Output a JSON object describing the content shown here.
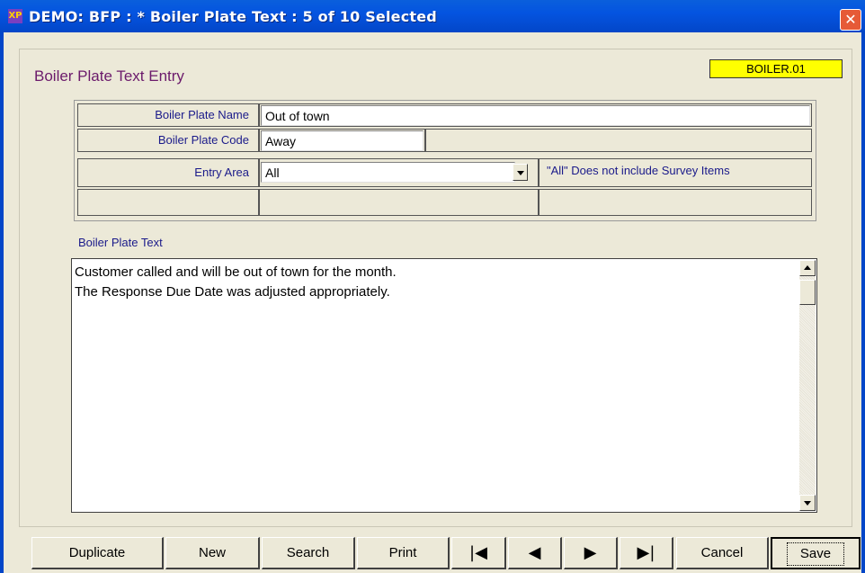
{
  "window": {
    "title": "DEMO:  BFP : * Boiler Plate Text : 5 of 10 Selected",
    "app_icon_text": "XP",
    "close_symbol": "✕"
  },
  "form": {
    "title": "Boiler Plate Text Entry",
    "badge": "BOILER.01",
    "badge_color": "#ffff00",
    "name_label": "Boiler Plate Name",
    "name_value": "Out of town",
    "code_label": "Boiler Plate Code",
    "code_value": "Away",
    "area_label": "Entry Area",
    "area_value": "All",
    "area_note": "\"All\" Does not include Survey Items",
    "text_label": "Boiler Plate Text",
    "text_lines": [
      "Customer called and will be out of town for the month.",
      "The Response Due Date was adjusted appropriately."
    ]
  },
  "toolbar": {
    "duplicate": "Duplicate",
    "new": "New",
    "search": "Search",
    "print": "Print",
    "first": "|◀",
    "prev": "◀",
    "next": "▶",
    "last": "▶|",
    "cancel": "Cancel",
    "save": "Save"
  }
}
